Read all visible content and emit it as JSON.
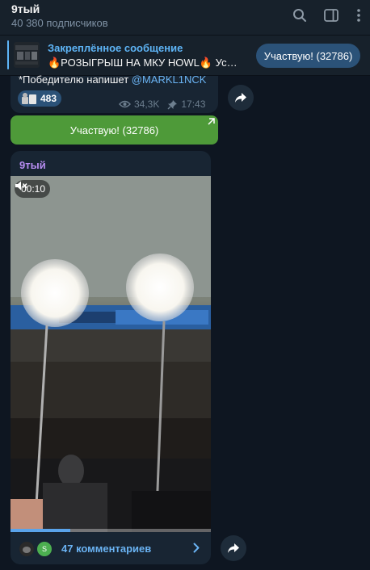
{
  "header": {
    "channel_title": "9тый",
    "subscribers": "40 380 подписчиков",
    "icons": [
      "search-icon",
      "sidebar-toggle-icon",
      "more-vertical-icon"
    ]
  },
  "pinned": {
    "title": "Закреплённое сообщение",
    "text": "🔥РОЗЫГРЫШ НА МКУ HOWL🔥 Ус…",
    "button_label": "Участвую! (32786)"
  },
  "message1": {
    "text_prefix": "*Победителю напишет ",
    "mention": "@MARKL1NCK",
    "reaction_count": "483",
    "views": "34,3K",
    "time": "17:43",
    "inline_button_label": "Участвую! (32786)"
  },
  "message2": {
    "author": "9тый",
    "video_time": "00:10",
    "progress": 0.3,
    "comment_avatar_letter": "S",
    "comments_label": "47 комментариев"
  },
  "colors": {
    "background": "#0e1621",
    "panel": "#17212b",
    "bubble": "#182533",
    "accent": "#5eb5f7",
    "green_button": "#4e9a39",
    "author_color": "#b68cf0"
  }
}
